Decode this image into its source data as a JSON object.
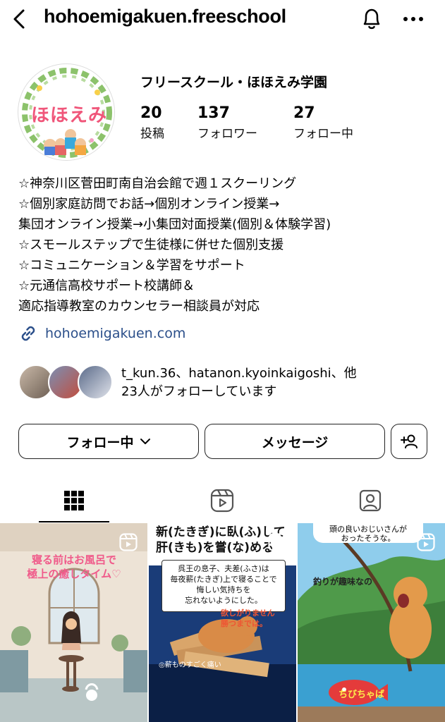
{
  "header": {
    "username": "hohoemigakuen.freeschool",
    "back_icon": "chevron-left-icon",
    "bell_icon": "bell-icon",
    "more_icon": "more-horizontal-icon"
  },
  "profile": {
    "avatar_text": "ほほえみ",
    "display_name": "フリースクール・ほほえみ学園",
    "stats": {
      "posts": {
        "count": "20",
        "label": "投稿"
      },
      "followers": {
        "count": "137",
        "label": "フォロワー"
      },
      "following": {
        "count": "27",
        "label": "フォロー中"
      }
    },
    "bio": [
      "☆神奈川区菅田町南自治会館で週１スクーリング",
      "☆個別家庭訪問でお話→個別オンライン授業→",
      "集団オンライン授業→小集団対面授業(個別＆体験学習)",
      "☆スモールステップで生徒様に併せた個別支援",
      "☆コミュニケーション＆学習をサポート",
      "☆元通信高校サポート校講師＆",
      "適応指導教室のカウンセラー相談員が対応"
    ],
    "link": "hohoemigakuen.com",
    "followed_by_line1": "t_kun.36、hatanon.kyoinkaigoshi、他",
    "followed_by_line2": "23人がフォローしています"
  },
  "actions": {
    "following_label": "フォロー中",
    "message_label": "メッセージ"
  },
  "tabs": [
    {
      "name": "posts-grid",
      "icon": "grid-icon",
      "active": true
    },
    {
      "name": "reels",
      "icon": "reels-icon",
      "active": false
    },
    {
      "name": "tagged",
      "icon": "tagged-person-icon",
      "active": false
    }
  ],
  "posts": [
    {
      "caption": "寝る前はお風呂で\n極上の癒しタイム♡"
    },
    {
      "top_text_1": "新(たきぎ)に臥(ふ)して",
      "top_text_2": "肝(きも)を嘗(な)める",
      "box_text": "呉王の息子、夫差(ふさ)は\n毎夜薪(たきぎ)上で寝ることで\n悔しい気持ちを\n忘れないようにした。",
      "red_text": "欲しがりません\n勝つまでは。",
      "foot_text": "◎薪ものすごく痛い"
    },
    {
      "bubble_text": "頭の良いおじいさんが\nおったそうな。",
      "label": "釣りが趣味なの",
      "chibi": "ちびちゃば"
    }
  ],
  "colors": {
    "link": "#2b4f8a",
    "avatar_text": "#f0567a",
    "c1_caption": "#f05a8a"
  }
}
